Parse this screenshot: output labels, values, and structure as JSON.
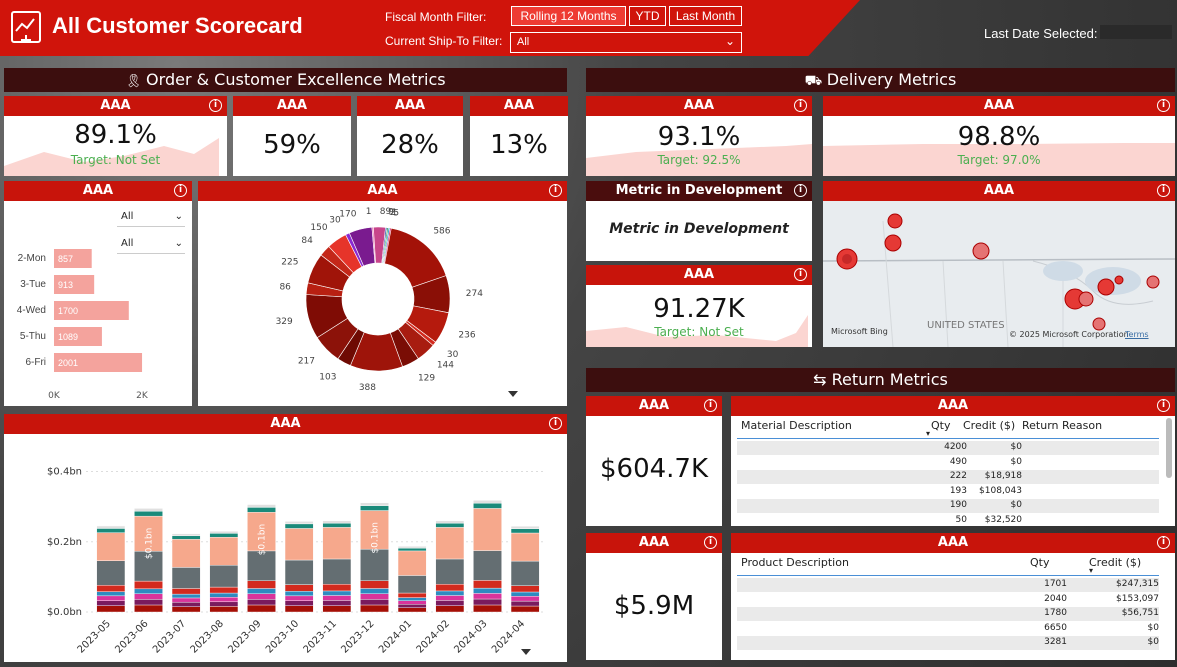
{
  "header": {
    "title": "All Customer Scorecard",
    "fiscal_label": "Fiscal Month Filter:",
    "fiscal_options": [
      "Rolling 12 Months",
      "YTD",
      "Last Month"
    ],
    "shipto_label": "Current Ship-To Filter:",
    "shipto_value": "All",
    "last_date_label": "Last Date Selected:"
  },
  "sections": {
    "order": "Order & Customer Excellence Metrics",
    "delivery": "Delivery Metrics",
    "returns": "Return Metrics"
  },
  "kpis": {
    "k1": {
      "title": "AAA",
      "value": "89.1%",
      "target": "Target: Not Set"
    },
    "k2": {
      "title": "AAA",
      "value": "59%"
    },
    "k3": {
      "title": "AAA",
      "value": "28%"
    },
    "k4": {
      "title": "AAA",
      "value": "13%"
    },
    "d1": {
      "title": "AAA",
      "value": "93.1%",
      "target": "Target: 92.5%"
    },
    "d2": {
      "title": "AAA",
      "value": "98.8%",
      "target": "Target: 97.0%"
    },
    "dev": {
      "title": "Metric in Development",
      "body": "Metric in Development"
    },
    "d3": {
      "title": "AAA",
      "value": "91.27K",
      "target": "Target: Not Set"
    },
    "r1": {
      "title": "AAA",
      "value": "$604.7K"
    },
    "r2": {
      "title": "AAA",
      "value": "$5.9M"
    }
  },
  "weekday_chart": {
    "title": "AAA",
    "filter1": "All",
    "filter2": "All",
    "axis_min": "0K",
    "axis_max": "2K"
  },
  "donut": {
    "title": "AAA"
  },
  "map": {
    "title": "AAA",
    "country": "UNITED STATES",
    "bing": "Microsoft Bing",
    "copyright": "© 2025 Microsoft Corporation",
    "terms": "Terms"
  },
  "stacked": {
    "title": "AAA",
    "y_ticks": [
      "$0.4bn",
      "$0.2bn",
      "$0.0bn"
    ],
    "bar_label": "$0.1bn"
  },
  "material_table": {
    "title": "AAA",
    "headers": [
      "Material Description",
      "Qty",
      "Credit ($)",
      "Return Reason"
    ],
    "rows": [
      {
        "qty": "4200",
        "credit": "$0"
      },
      {
        "qty": "490",
        "credit": "$0"
      },
      {
        "qty": "222",
        "credit": "$18,918"
      },
      {
        "qty": "193",
        "credit": "$108,043"
      },
      {
        "qty": "190",
        "credit": "$0"
      },
      {
        "qty": "50",
        "credit": "$32,520"
      }
    ]
  },
  "product_table": {
    "title": "AAA",
    "headers": [
      "Product Description",
      "Qty",
      "Credit ($)"
    ],
    "rows": [
      {
        "qty": "1701",
        "credit": "$247,315"
      },
      {
        "qty": "2040",
        "credit": "$153,097"
      },
      {
        "qty": "1780",
        "credit": "$56,751"
      },
      {
        "qty": "6650",
        "credit": "$0"
      },
      {
        "qty": "3281",
        "credit": "$0"
      }
    ]
  },
  "chart_data": [
    {
      "type": "bar",
      "orientation": "horizontal",
      "categories": [
        "2-Mon",
        "3-Tue",
        "4-Wed",
        "5-Thu",
        "6-Fri"
      ],
      "values": [
        857,
        913,
        1700,
        1089,
        2001
      ],
      "xlim": [
        0,
        2000
      ],
      "color": "#f4a39d"
    },
    {
      "type": "pie",
      "donut": true,
      "values": [
        586,
        274,
        236,
        30,
        144,
        129,
        388,
        103,
        217,
        329,
        86,
        225,
        84,
        150,
        30,
        170,
        1,
        89,
        9,
        2,
        1,
        5
      ],
      "colors": [
        "#a31208",
        "#8a0f06",
        "#b51a0d",
        "#d32a1e",
        "#a81c10",
        "#7a0d05",
        "#9e140a",
        "#6e0a03",
        "#8c1209",
        "#7f0c05",
        "#b82012",
        "#a01409",
        "#c42719",
        "#e6342a",
        "#8a2ad1",
        "#7a1b8f",
        "#e05aa0",
        "#c8458a",
        "#1f3fa8",
        "#2a9d46",
        "#0a84c8",
        "#d81b60"
      ]
    },
    {
      "type": "bar",
      "stacked": true,
      "categories": [
        "2023-05",
        "2023-06",
        "2023-07",
        "2023-08",
        "2023-09",
        "2023-10",
        "2023-11",
        "2023-12",
        "2024-01",
        "2024-02",
        "2024-03",
        "2024-04"
      ],
      "ylim": [
        0,
        0.45
      ],
      "series": [
        {
          "values": [
            0.018,
            0.02,
            0.015,
            0.016,
            0.02,
            0.018,
            0.018,
            0.02,
            0.012,
            0.018,
            0.02,
            0.017
          ],
          "color": "#a50f06"
        },
        {
          "values": [
            0.014,
            0.016,
            0.013,
            0.013,
            0.016,
            0.014,
            0.015,
            0.016,
            0.01,
            0.015,
            0.017,
            0.014
          ],
          "color": "#7a1b5e"
        },
        {
          "values": [
            0.014,
            0.016,
            0.012,
            0.013,
            0.016,
            0.014,
            0.014,
            0.016,
            0.01,
            0.014,
            0.016,
            0.014
          ],
          "color": "#d9349b"
        },
        {
          "values": [
            0.012,
            0.014,
            0.011,
            0.012,
            0.015,
            0.013,
            0.013,
            0.015,
            0.009,
            0.013,
            0.015,
            0.012
          ],
          "color": "#2e8bc0"
        },
        {
          "values": [
            0.018,
            0.022,
            0.016,
            0.017,
            0.022,
            0.019,
            0.019,
            0.022,
            0.013,
            0.019,
            0.022,
            0.018
          ],
          "color": "#d32a1e"
        },
        {
          "values": [
            0.07,
            0.085,
            0.06,
            0.062,
            0.085,
            0.07,
            0.072,
            0.09,
            0.05,
            0.072,
            0.085,
            0.07
          ],
          "color": "#646e72"
        },
        {
          "values": [
            0.08,
            0.1,
            0.08,
            0.08,
            0.11,
            0.09,
            0.09,
            0.11,
            0.07,
            0.09,
            0.12,
            0.08
          ],
          "color": "#f6a88c"
        },
        {
          "values": [
            0.012,
            0.014,
            0.01,
            0.011,
            0.014,
            0.013,
            0.012,
            0.014,
            0.008,
            0.012,
            0.015,
            0.012
          ],
          "color": "#1a8a7a"
        },
        {
          "values": [
            0.007,
            0.008,
            0.006,
            0.006,
            0.008,
            0.007,
            0.007,
            0.008,
            0.005,
            0.007,
            0.008,
            0.007
          ],
          "color": "#e0e0e0"
        }
      ]
    }
  ]
}
